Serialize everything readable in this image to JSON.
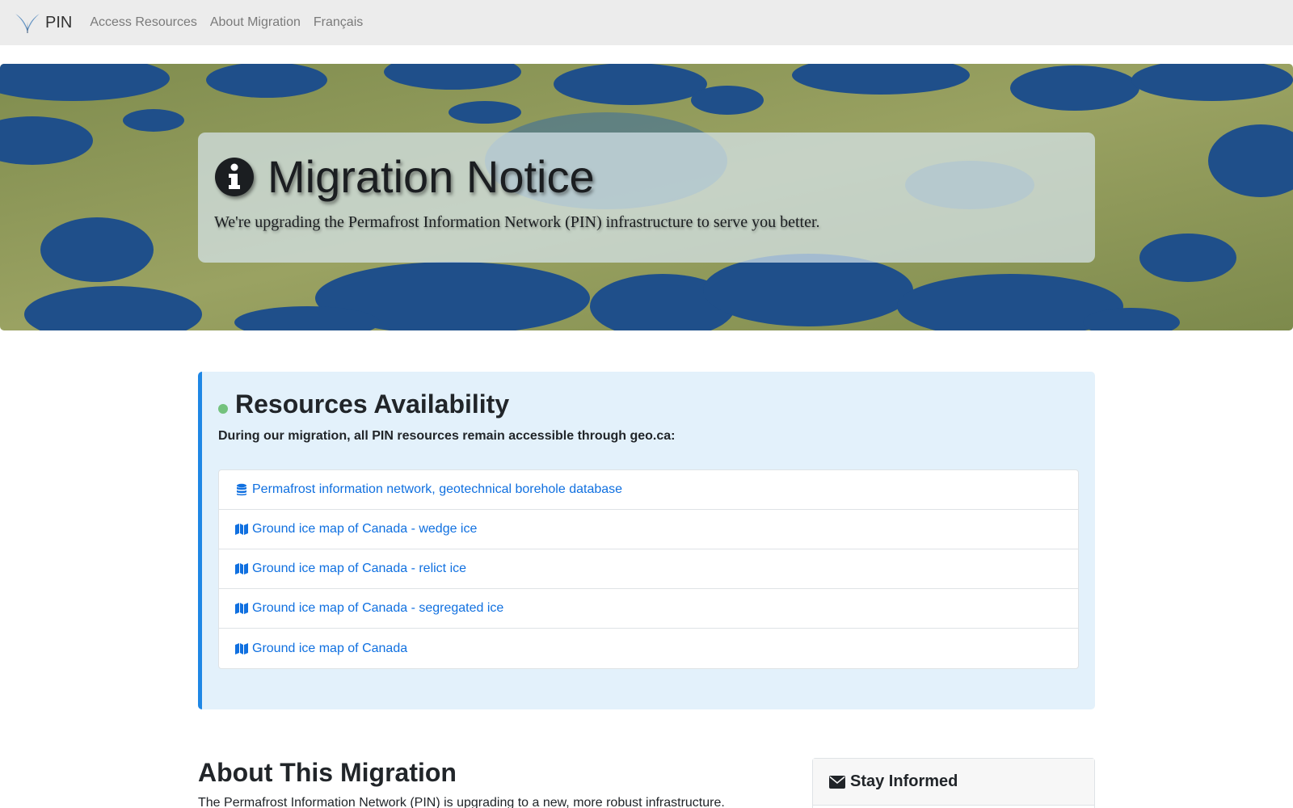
{
  "nav": {
    "brand": "PIN",
    "links": [
      "Access Resources",
      "About Migration",
      "Français"
    ]
  },
  "hero": {
    "title": "Migration Notice",
    "subtitle": "We're upgrading the Permafrost Information Network (PIN) infrastructure to serve you better."
  },
  "resources": {
    "title": "Resources Availability",
    "intro": "During our migration, all PIN resources remain accessible through geo.ca:",
    "status_color": "#73c27d",
    "accent_color": "#1f87e5",
    "items": [
      {
        "icon": "database-icon",
        "label": "Permafrost information network, geotechnical borehole database"
      },
      {
        "icon": "map-icon",
        "label": "Ground ice map of Canada - wedge ice"
      },
      {
        "icon": "map-icon",
        "label": "Ground ice map of Canada - relict ice"
      },
      {
        "icon": "map-icon",
        "label": "Ground ice map of Canada - segregated ice"
      },
      {
        "icon": "map-icon",
        "label": "Ground ice map of Canada"
      }
    ]
  },
  "about": {
    "title": "About This Migration",
    "text": "The Permafrost Information Network (PIN) is upgrading to a new, more robust infrastructure."
  },
  "stay": {
    "icon": "envelope-icon",
    "title": "Stay Informed"
  }
}
